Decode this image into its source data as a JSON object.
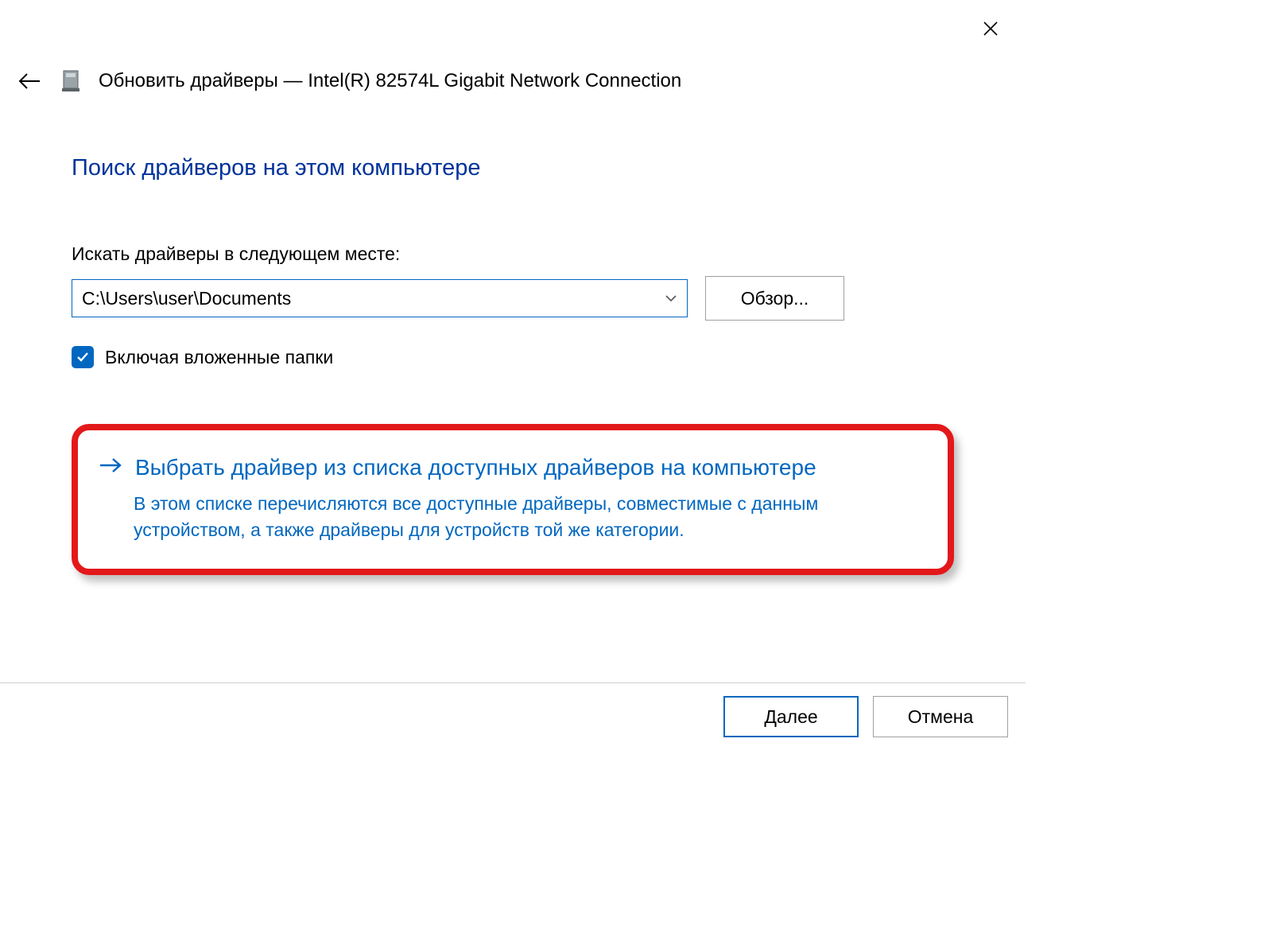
{
  "window": {
    "title": "Обновить драйверы — Intel(R) 82574L Gigabit Network Connection"
  },
  "main": {
    "heading": "Поиск драйверов на этом компьютере",
    "search_label": "Искать драйверы в следующем месте:",
    "path_value": "C:\\Users\\user\\Documents",
    "browse_label": "Обзор...",
    "include_subfolders_label": "Включая вложенные папки",
    "include_subfolders_checked": true
  },
  "option": {
    "title": "Выбрать драйвер из списка доступных драйверов на компьютере",
    "description": "В этом списке перечисляются все доступные драйверы, совместимые с данным устройством, а также драйверы для устройств той же категории."
  },
  "footer": {
    "next_label": "Далее",
    "cancel_label": "Отмена"
  }
}
